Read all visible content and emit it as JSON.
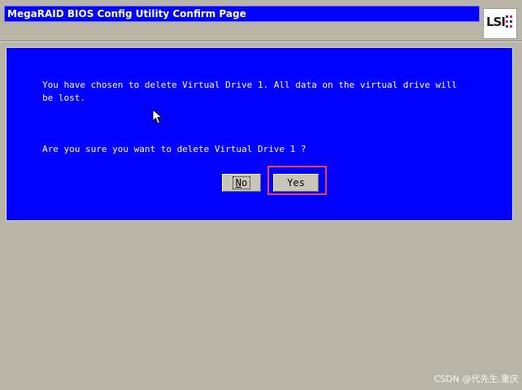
{
  "window": {
    "title": "MegaRAID BIOS Config Utility  Confirm Page"
  },
  "logo": {
    "text": "LSI",
    "icon": "lsi-logo-icon",
    "accent_colors": [
      "#1a3fa0",
      "#e03030"
    ]
  },
  "dialog": {
    "message": "You have chosen to delete Virtual Drive 1. All data on the virtual drive will\nbe lost.",
    "question": "Are you sure you want to delete Virtual Drive 1 ?",
    "buttons": {
      "no_label": "No",
      "yes_label": "Yes"
    },
    "highlight_color": "#e8464a"
  },
  "colors": {
    "panel_blue": "#0000ff",
    "background_gray": "#b8b4a8",
    "button_gray": "#c9c5b8"
  },
  "watermark": {
    "text": "CSDN @代先生.重庆"
  }
}
